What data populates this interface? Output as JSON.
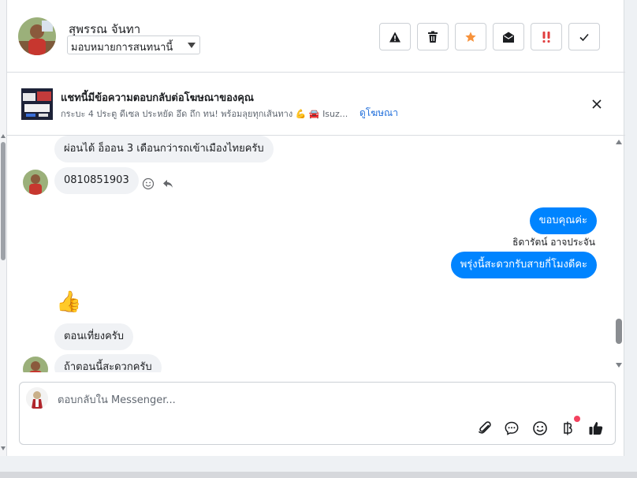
{
  "header": {
    "contact_name": "สุพรรณ จันทา",
    "assign_label": "มอบหมายการสนทนานี้"
  },
  "ad_banner": {
    "title": "แชทนี้มีข้อความตอบกลับต่อโฆษณาของคุณ",
    "subtitle": "กระบะ 4 ประตู ดีเซล ประหยัด อึด ถึก ทน! พร้อมลุยทุกเส้นทาง 💪 🚘 Isuz...",
    "link": "ดูโฆษณา"
  },
  "messages": [
    {
      "text": "ผ่อนได้ อ็ออน 3 เดือนกว่ารถเข้าเมืองไทยครับ",
      "from": "contact"
    },
    {
      "text": "0810851903",
      "from": "contact"
    },
    {
      "text": "ขอบคุณค่ะ",
      "from": "page"
    },
    {
      "text": "ธิดารัตน์ อาจประจัน",
      "from": "label"
    },
    {
      "text": "พรุ่งนี้สะดวกรับสายกี่โมงดีคะ",
      "from": "page"
    },
    {
      "text": "👍",
      "from": "contact"
    },
    {
      "text": "ตอนเที่ยงครับ",
      "from": "contact"
    },
    {
      "text": "ถ้าตอนนี้สะดวกครับ",
      "from": "contact"
    }
  ],
  "composer": {
    "placeholder": "ตอบกลับใน Messenger..."
  },
  "colors": {
    "accent": "#0084ff",
    "star": "#f7923b",
    "urgent": "#e03e3e",
    "notification_dot": "#f3425f",
    "link": "#216fdb"
  },
  "icons": [
    "warning-icon",
    "trash-icon",
    "star-icon",
    "envelope-open-icon",
    "exclamation-icon",
    "check-icon",
    "close-icon",
    "smiley-icon",
    "reply-icon",
    "paperclip-icon",
    "chat-bubble-icon",
    "emoji-icon",
    "baht-icon",
    "thumbs-up-icon"
  ]
}
